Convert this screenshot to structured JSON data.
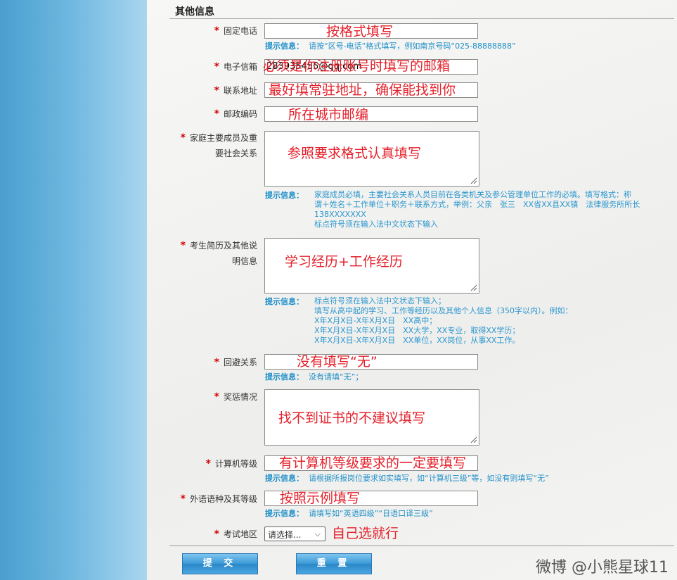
{
  "section_title": "其他信息",
  "fields": {
    "phone": {
      "label": "固定电话",
      "value": "",
      "hint_title": "提示信息：",
      "hint": "请按“区号-电话”格式填写，例如南京号码“025-88888888”",
      "annotation": "按格式填写"
    },
    "email": {
      "label": "电子信箱",
      "value": "283935455@qq.com",
      "annotation": "必须是你注册账号时填写的邮箱"
    },
    "address": {
      "label": "联系地址",
      "value": "",
      "annotation": "最好填常驻地址，确保能找到你"
    },
    "postcode": {
      "label": "邮政编码",
      "value": "",
      "annotation": "所在城市邮编"
    },
    "family": {
      "label_line1": "家庭主要成员及重",
      "label_line2": "要社会关系",
      "value": "",
      "annotation": "参照要求格式认真填写",
      "hint_title": "提示信息：",
      "hint_lines": [
        "家庭成员必填，主要社会关系人员目前在各类机关及参公管理单位工作的必填。填写格式：称",
        "谓＋姓名＋工作单位＋职务＋联系方式，举例：父亲　张三　XX省XX县XX镇　法律服务所所长",
        "138XXXXXXX",
        "标点符号须在输入法中文状态下输入"
      ]
    },
    "resume": {
      "label_line1": "考生简历及其他说",
      "label_line2": "明信息",
      "value": "",
      "annotation": "学习经历+工作经历",
      "hint_title": "提示信息：",
      "hint_lines": [
        "标点符号须在输入法中文状态下输入；",
        "填写从高中起的学习、工作等经历以及其他个人信息（350字以内）。例如：",
        "X年X月X日-X年X月X日　XX高中；",
        "X年X月X日-X年X月X日　XX大学，XX专业，取得XX学历；",
        "X年X月X日-X年X月X日　XX单位，XX岗位，从事XX工作。"
      ]
    },
    "avoidance": {
      "label": "回避关系",
      "value": "",
      "annotation": "没有填写“无”",
      "hint_title": "提示信息：",
      "hint": "没有请填“无”；"
    },
    "awards": {
      "label": "奖惩情况",
      "value": "",
      "annotation": "找不到证书的不建议填写"
    },
    "computer": {
      "label": "计算机等级",
      "value": "",
      "annotation": "有计算机等级要求的一定要填写",
      "hint_title": "提示信息：",
      "hint": "请根据所报岗位要求如实填写，如“计算机三级”等，如没有则填写“无”"
    },
    "language": {
      "label": "外语语种及其等级",
      "value": "",
      "annotation": "按照示例填写",
      "hint_title": "提示信息：",
      "hint": "请填写如“英语四级”“日语口译三级”"
    },
    "region": {
      "label": "考试地区",
      "selected": "请选择...",
      "annotation": "自己选就行"
    }
  },
  "buttons": {
    "submit": "提 交",
    "reset": "重 置"
  },
  "watermark": "微博 @小熊星球11",
  "colors": {
    "required_star": "#d40000",
    "hint": "#1f8fc9",
    "annotation": "#e4202a",
    "left_panel": "#6cb6df"
  }
}
